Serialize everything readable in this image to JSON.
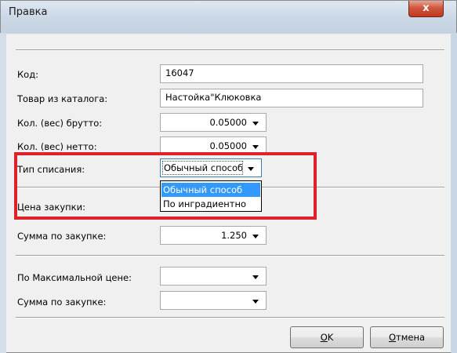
{
  "window": {
    "title": "Правка",
    "close_glyph": "x"
  },
  "fields": {
    "code": {
      "label": "Код:",
      "value": "16047"
    },
    "catalog_item": {
      "label": "Товар из каталога:",
      "value": "Настойка\"Клюковка"
    },
    "gross": {
      "label": "Кол. (вес) брутто:",
      "value": "0.05000"
    },
    "net": {
      "label": "Кол. (вес) нетто:",
      "value": "0.05000"
    },
    "writeoff_type": {
      "label": "Тип списания:",
      "value": "Обычный способ",
      "options": [
        "Обычный способ",
        "По инградиентно"
      ],
      "selected_index": 0
    },
    "purchase_price": {
      "label": "Цена закупки:"
    },
    "purchase_sum": {
      "label": "Сумма по закупке:",
      "value": "1.250"
    },
    "max_price": {
      "label": "По Максимальной цене:",
      "value": ""
    },
    "purchase_sum2": {
      "label": "Сумма по закупке:",
      "value": ""
    }
  },
  "buttons": {
    "ok": {
      "mnemonic": "O",
      "rest": "K"
    },
    "cancel": {
      "mnemonic": "О",
      "rest": "тмена"
    }
  },
  "colors": {
    "highlight": "#e0212b",
    "selection": "#3399ff"
  }
}
